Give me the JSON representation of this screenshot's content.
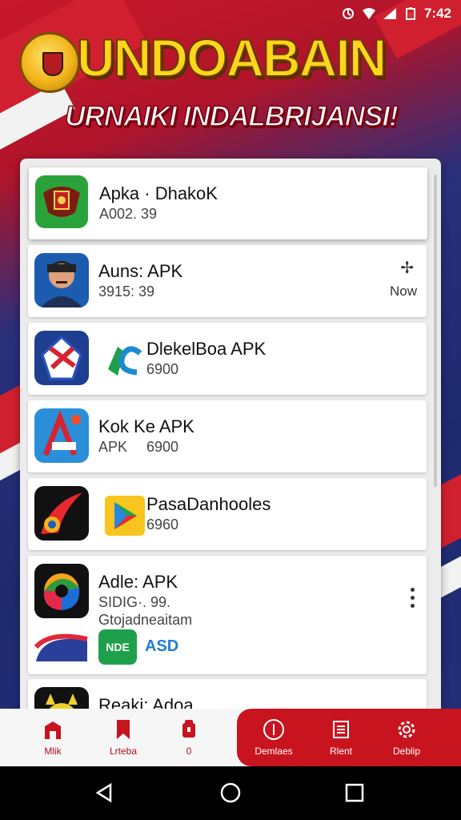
{
  "status": {
    "time": "7:42"
  },
  "header": {
    "title": "UNDOABAIN",
    "subtitle": "URNAIKI INDALBRIJANSI!"
  },
  "apps": [
    {
      "name": "Apka · DhakoK",
      "sub": "A002. 39",
      "icon": "garuda-icon"
    },
    {
      "name": "Auns: APK",
      "sub": "3915: 39",
      "right_label": "Now",
      "icon": "man-avatar-icon"
    },
    {
      "name": "DlekelBoa APK",
      "sub": "6900",
      "icon": "star-badge-icon"
    },
    {
      "name": "Kok   Ke APK",
      "sub_a": "APK",
      "sub_b": "6900",
      "icon": "letter-a-icon"
    },
    {
      "name": "PasaDanhooles",
      "sub": "6960",
      "icon": "play-store-icon"
    },
    {
      "name": "Adle: APK",
      "sub": "SIDIG·. 99.",
      "sub2": "Gtojadneaitam",
      "icon": "rainbow-circle-icon"
    },
    {
      "name": "ASD",
      "icon": "nde-badge-icon"
    },
    {
      "name": "Reaki: Adoa",
      "icon": "cartoon-face-icon"
    }
  ],
  "bottom_nav": [
    {
      "label": "Mlik",
      "icon": "home-icon"
    },
    {
      "label": "Lrteba",
      "icon": "bookmark-icon"
    },
    {
      "label": "0",
      "icon": "android-icon"
    },
    {
      "label": "Demlaes",
      "icon": "info-icon"
    },
    {
      "label": "Rlent",
      "icon": "list-icon"
    },
    {
      "label": "Deblip",
      "icon": "gear-icon"
    }
  ],
  "colors": {
    "accent": "#c8141f",
    "title": "#ffd51c",
    "panel": "#ececec"
  }
}
